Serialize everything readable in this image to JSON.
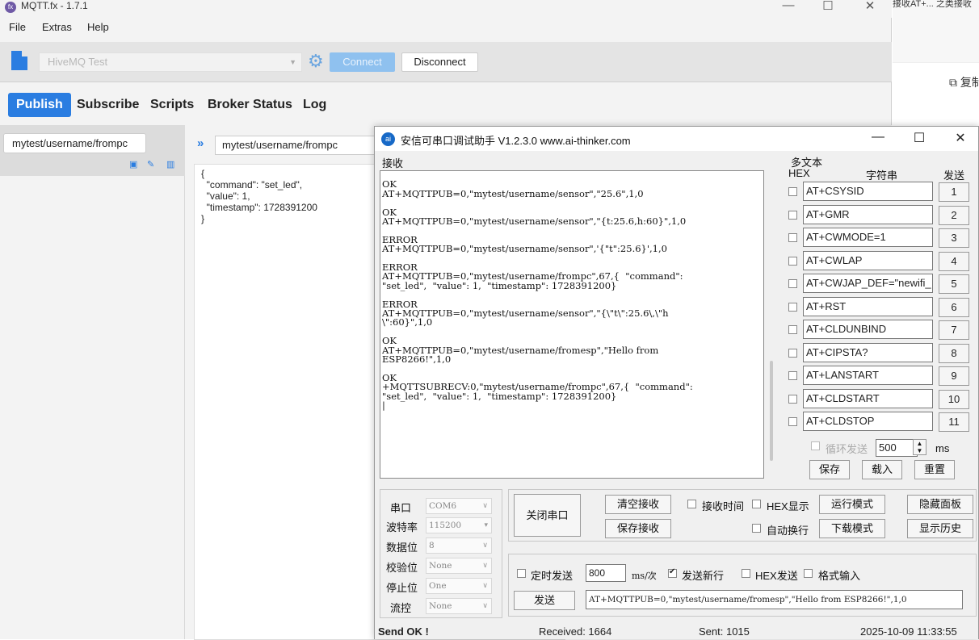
{
  "mqtt": {
    "window_title": "MQTT.fx - 1.7.1",
    "menu": [
      "File",
      "Extras",
      "Help"
    ],
    "profile": "HiveMQ Test",
    "connect_label": "Connect",
    "disconnect_label": "Disconnect",
    "tabs": [
      "Publish",
      "Subscribe",
      "Scripts",
      "Broker Status",
      "Log"
    ],
    "topic_item": "mytest/username/frompc",
    "publish_topic": "mytest/username/frompc",
    "payload_lines": [
      "{",
      "  \"command\": \"set_led\",",
      "  \"value\": 1,",
      "  \"timestamp\": 1728391200",
      "}"
    ]
  },
  "browser": {
    "top_text": "接收AT+... 之类接收",
    "copy_label": "复制"
  },
  "serial": {
    "window_title": "安信可串口调试助手 V1.2.3.0    www.ai-thinker.com",
    "recv_label": "接收",
    "recv_lines": [
      "",
      "OK",
      "AT+MQTTPUB=0,\"mytest/username/sensor\",\"25.6\",1,0",
      "",
      "OK",
      "AT+MQTTPUB=0,\"mytest/username/sensor\",\"{t:25.6,h:60}\",1,0",
      "",
      "ERROR",
      "AT+MQTTPUB=0,\"mytest/username/sensor\",'{\"t\":25.6}',1,0",
      "",
      "ERROR",
      "AT+MQTTPUB=0,\"mytest/username/frompc\",67,{  \"command\":",
      "\"set_led\",  \"value\": 1,  \"timestamp\": 1728391200}",
      "",
      "ERROR",
      "AT+MQTTPUB=0,\"mytest/username/sensor\",\"{\\\"t\\\":25.6\\,\\\"h",
      "\\\":60}\",1,0",
      "",
      "OK",
      "AT+MQTTPUB=0,\"mytest/username/fromesp\",\"Hello from",
      "ESP8266!\",1,0",
      "",
      "OK",
      "+MQTTSUBRECV:0,\"mytest/username/frompc\",67,{  \"command\":",
      "\"set_led\",  \"value\": 1,  \"timestamp\": 1728391200}",
      "|"
    ],
    "multi_text_label": "多文本",
    "hex_label": "HEX",
    "string_label": "字符串",
    "send_col_label": "发送",
    "commands": [
      {
        "text": "AT+CSYSID",
        "num": "1"
      },
      {
        "text": "AT+GMR",
        "num": "2"
      },
      {
        "text": "AT+CWMODE=1",
        "num": "3"
      },
      {
        "text": "AT+CWLAP",
        "num": "4"
      },
      {
        "text": "AT+CWJAP_DEF=\"newifi_",
        "num": "5"
      },
      {
        "text": "AT+RST",
        "num": "6"
      },
      {
        "text": "AT+CLDUNBIND",
        "num": "7"
      },
      {
        "text": "AT+CIPSTA?",
        "num": "8"
      },
      {
        "text": "AT+LANSTART",
        "num": "9"
      },
      {
        "text": "AT+CLDSTART",
        "num": "10"
      },
      {
        "text": "AT+CLDSTOP",
        "num": "11"
      }
    ],
    "loop_send_label": "循环发送",
    "loop_interval": "500",
    "ms_label": "ms",
    "save_label": "保存",
    "load_label": "载入",
    "reset_label": "重置",
    "port_label": "串口",
    "port_value": "COM6",
    "baud_label": "波特率",
    "baud_value": "115200",
    "databits_label": "数据位",
    "databits_value": "8",
    "parity_label": "校验位",
    "parity_value": "None",
    "stopbits_label": "停止位",
    "stopbits_value": "One",
    "flow_label": "流控",
    "flow_value": "None",
    "close_port_label": "关闭串口",
    "clear_recv_label": "清空接收",
    "save_recv_label": "保存接收",
    "recv_time_label": "接收时间",
    "hex_display_label": "HEX显示",
    "run_mode_label": "运行模式",
    "hide_panel_label": "隐藏面板",
    "auto_wrap_label": "自动换行",
    "download_mode_label": "下载模式",
    "show_history_label": "显示历史",
    "timed_send_label": "定时发送",
    "timed_interval": "800",
    "ms_per_label": "ms/次",
    "send_newline_label": "发送新行",
    "hex_send_label": "HEX发送",
    "format_input_label": "格式输入",
    "send_button": "发送",
    "send_text": "AT+MQTTPUB=0,\"mytest/username/fromesp\",\"Hello from ESP8266!\",1,0",
    "status_send": "Send OK !",
    "status_received": "Received: 1664",
    "status_sent": "Sent: 1015",
    "status_time": "2025-10-09 11:33:55"
  }
}
